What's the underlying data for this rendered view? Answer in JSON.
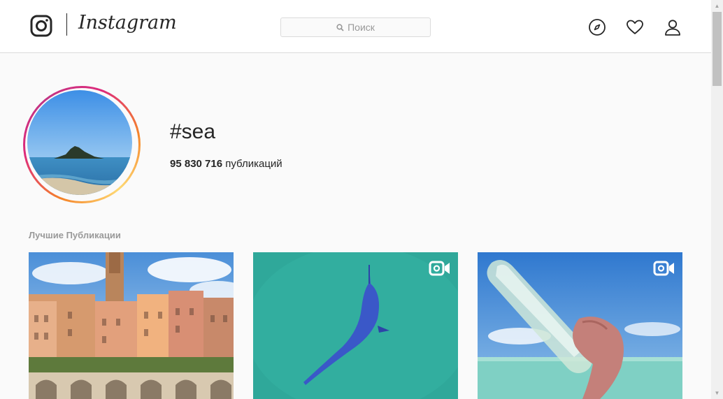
{
  "header": {
    "logo_text": "Instagram",
    "search_placeholder": "Поиск"
  },
  "icons": {
    "logo": "instagram-camera-icon",
    "search": "search-icon",
    "explore": "compass-icon",
    "activity": "heart-icon",
    "profile": "user-icon",
    "video": "video-camera-icon"
  },
  "tag": {
    "name": "#sea",
    "post_count": "95 830 716",
    "post_label": "публикаций"
  },
  "top_posts": {
    "title": "Лучшие Публикации",
    "items": [
      {
        "kind": "photo"
      },
      {
        "kind": "video"
      },
      {
        "kind": "video"
      }
    ]
  },
  "colors": {
    "background": "#fafafa",
    "border": "#dbdbdb",
    "text": "#262626",
    "muted": "#999999",
    "ring_start": "#f58529",
    "ring_end": "#dd2a7b"
  }
}
